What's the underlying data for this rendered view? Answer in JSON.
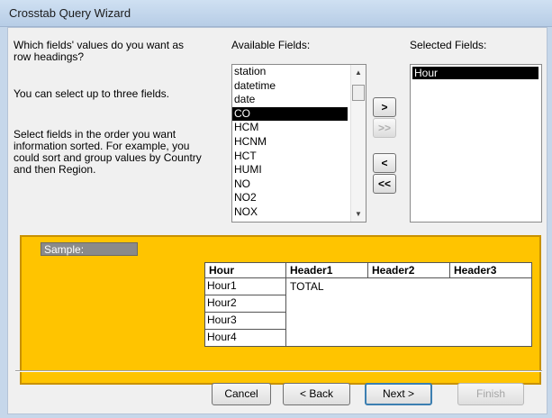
{
  "window": {
    "title": "Crosstab Query Wizard"
  },
  "instructions": {
    "question_line1": "Which fields' values do you want as",
    "question_line2": "row headings?",
    "limit": "You can select up to three fields.",
    "order_line1": "Select fields in the order you want",
    "order_line2": "information sorted.  For example, you",
    "order_line3": "could sort and group values by Country",
    "order_line4": "and then Region."
  },
  "available_fields": {
    "label": "Available Fields:",
    "items": [
      "station",
      "datetime",
      "date",
      "CO",
      "HCM",
      "HCNM",
      "HCT",
      "HUMI",
      "NO",
      "NO2",
      "NOX"
    ],
    "selected": "CO"
  },
  "selected_fields": {
    "label": "Selected Fields:",
    "items": [
      "Hour"
    ]
  },
  "move_buttons": {
    "add_one": ">",
    "add_all": ">>",
    "remove_one": "<",
    "remove_all": "<<"
  },
  "sample": {
    "label": "Sample:",
    "headers": [
      "Hour",
      "Header1",
      "Header2",
      "Header3"
    ],
    "rows": [
      "Hour1",
      "Hour2",
      "Hour3",
      "Hour4"
    ],
    "value": "TOTAL"
  },
  "buttons": {
    "cancel": "Cancel",
    "back": "< Back",
    "next": "Next >",
    "finish": "Finish"
  }
}
